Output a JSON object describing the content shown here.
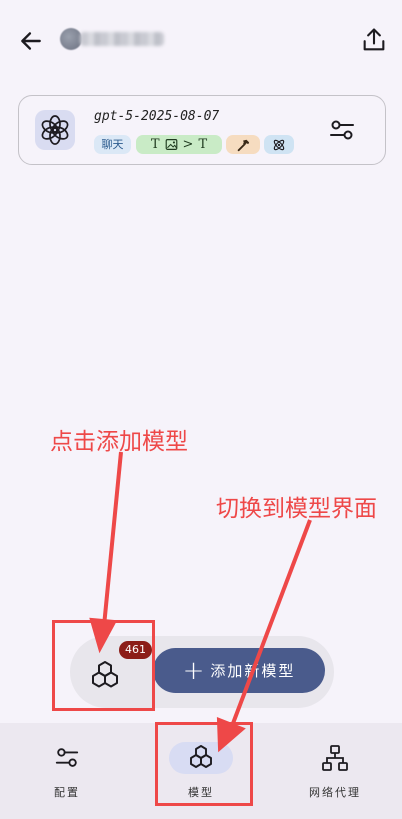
{
  "header": {
    "back_icon": "arrow-left-icon",
    "share_icon": "share-upload-icon"
  },
  "model_card": {
    "name": "gpt-5-2025-08-07",
    "logo_icon": "openai-logo-icon",
    "tag_chat": "聊天",
    "modality_input": "T",
    "modality_arrow": ">",
    "modality_output": "T",
    "tool_icon": "hammer-icon",
    "reasoning_icon": "atom-icon",
    "settings_icon": "sliders-icon"
  },
  "annotations": {
    "click_add": "点击添加模型",
    "switch_view": "切换到模型界面",
    "color": "#ee4848"
  },
  "floating_bar": {
    "models_count": "461",
    "add_button_label": "添加新模型",
    "add_icon": "plus-icon"
  },
  "nav": {
    "config_label": "配置",
    "models_label": "模型",
    "proxy_label": "网络代理"
  },
  "colors": {
    "background": "#f6f3fa",
    "primary_button": "#4a5b8c",
    "badge": "#8c1d18",
    "nav_selected": "#d8dcf3"
  }
}
